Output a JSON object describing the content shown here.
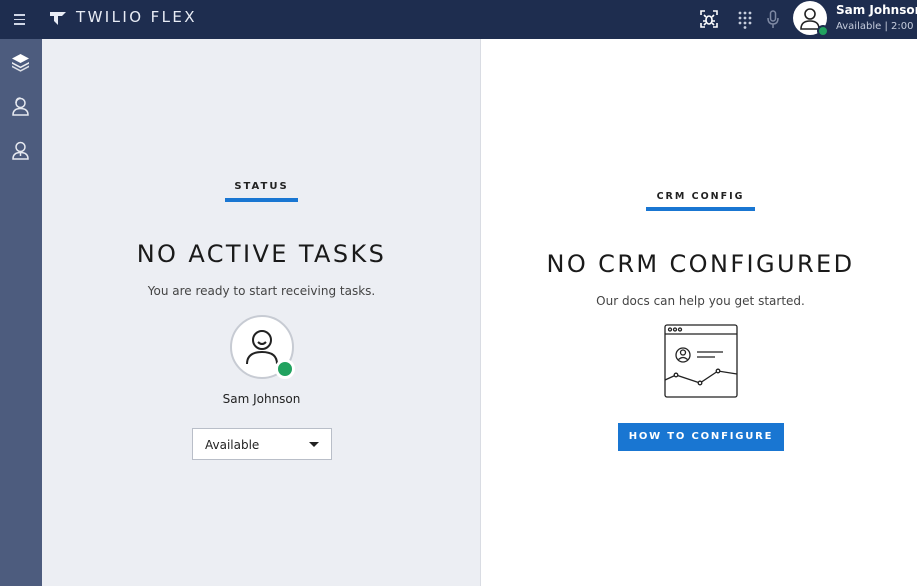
{
  "header": {
    "brand": "TWILIO FLEX",
    "user_name": "Sam Johnson",
    "user_status": "Available | 2:00"
  },
  "status_panel": {
    "section_label": "STATUS",
    "title": "NO ACTIVE TASKS",
    "subtitle": "You are ready to start receiving tasks.",
    "agent_name": "Sam Johnson",
    "activity_value": "Available"
  },
  "crm_panel": {
    "section_label": "CRM CONFIG",
    "title": "NO CRM CONFIGURED",
    "subtitle": "Our docs can help you get started.",
    "button_label": "HOW TO CONFIGURE"
  },
  "colors": {
    "topbar": "#1e2d4f",
    "sidebar": "#4d5c7e",
    "accent": "#1976d2",
    "available": "#21a25f"
  },
  "icons": [
    "hamburger-icon",
    "twilio-logo-icon",
    "bug-icon",
    "dialpad-icon",
    "microphone-icon",
    "user-avatar-icon",
    "layers-icon",
    "agent-icon",
    "teams-icon",
    "crm-illustration-icon"
  ]
}
